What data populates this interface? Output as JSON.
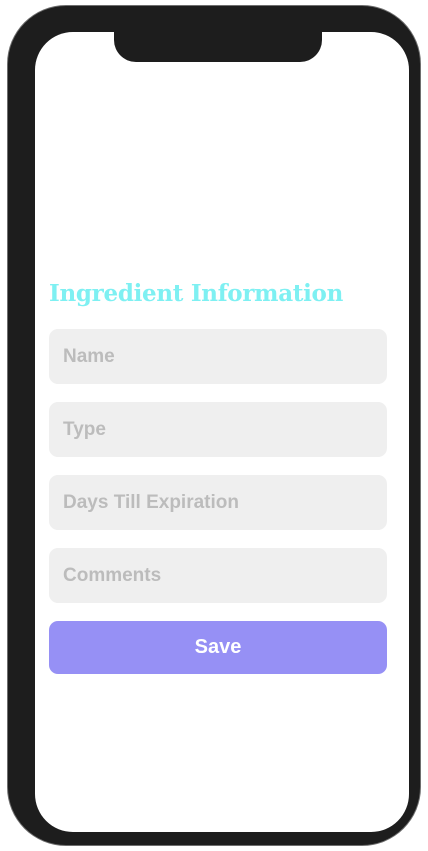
{
  "form": {
    "title": "Ingredient Information",
    "fields": [
      {
        "name": "name",
        "placeholder": "Name",
        "value": ""
      },
      {
        "name": "type",
        "placeholder": "Type",
        "value": ""
      },
      {
        "name": "days",
        "placeholder": "Days Till Expiration",
        "value": ""
      },
      {
        "name": "comments",
        "placeholder": "Comments",
        "value": ""
      }
    ],
    "save_label": "Save"
  },
  "colors": {
    "title": "#7ef0f2",
    "field_background": "#efefef",
    "placeholder": "#bcbcbc",
    "button": "#9690f5",
    "button_text": "#ffffff",
    "device_frame": "#1d1d1d"
  }
}
